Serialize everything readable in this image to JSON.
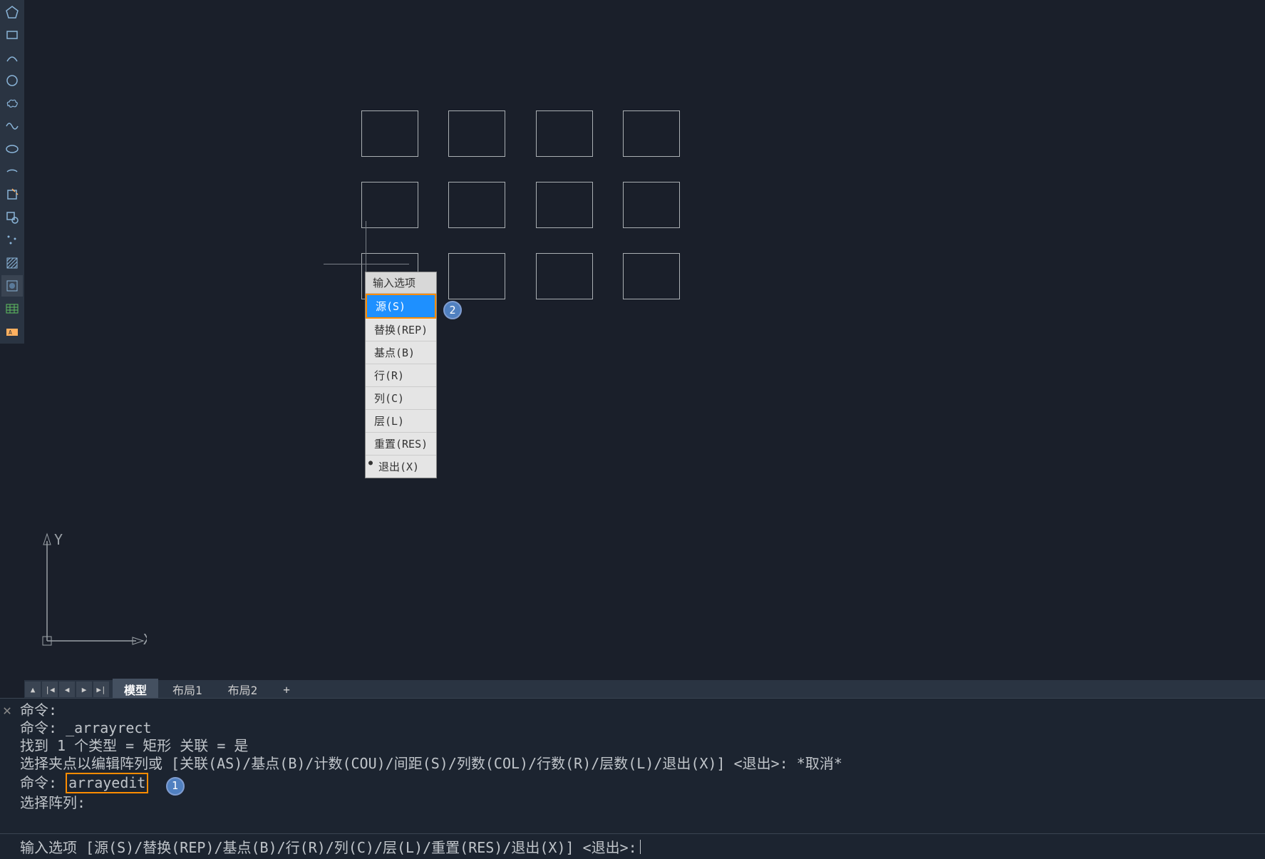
{
  "toolbar": {
    "tools": [
      {
        "name": "polygon",
        "glyph": "⬠"
      },
      {
        "name": "rectangle",
        "glyph": "▭"
      },
      {
        "name": "arc",
        "glyph": "◠"
      },
      {
        "name": "circle",
        "glyph": "◯"
      },
      {
        "name": "revision-cloud",
        "glyph": "☁"
      },
      {
        "name": "spline",
        "glyph": "∿"
      },
      {
        "name": "ellipse",
        "glyph": "⬭"
      },
      {
        "name": "ellipse-arc",
        "glyph": "◖"
      },
      {
        "name": "insert-block",
        "glyph": "⬚"
      },
      {
        "name": "make-block",
        "glyph": "⊡"
      },
      {
        "name": "point",
        "glyph": "∴"
      },
      {
        "name": "hatch",
        "glyph": "▨"
      },
      {
        "name": "gradient",
        "glyph": "◫"
      },
      {
        "name": "table",
        "glyph": "▦"
      },
      {
        "name": "text",
        "glyph": "A"
      }
    ]
  },
  "context_menu": {
    "header": "输入选项",
    "items": [
      {
        "label": "源(S)",
        "selected": true,
        "bullet": false
      },
      {
        "label": "替换(REP)",
        "selected": false,
        "bullet": false
      },
      {
        "label": "基点(B)",
        "selected": false,
        "bullet": false
      },
      {
        "label": "行(R)",
        "selected": false,
        "bullet": false
      },
      {
        "label": "列(C)",
        "selected": false,
        "bullet": false
      },
      {
        "label": "层(L)",
        "selected": false,
        "bullet": false
      },
      {
        "label": "重置(RES)",
        "selected": false,
        "bullet": false
      },
      {
        "label": "退出(X)",
        "selected": false,
        "bullet": true
      }
    ]
  },
  "badges": {
    "b1": "1",
    "b2": "2"
  },
  "axes": {
    "x": "X",
    "y": "Y"
  },
  "tabs": {
    "items": [
      {
        "label": "模型",
        "active": true
      },
      {
        "label": "布局1",
        "active": false
      },
      {
        "label": "布局2",
        "active": false
      },
      {
        "label": "+",
        "active": false
      }
    ]
  },
  "command_history": {
    "l1": "命令:",
    "l2": "命令: _arrayrect",
    "l3": "找到 1 个类型 = 矩形   关联 = 是",
    "l4": "选择夹点以编辑阵列或 [关联(AS)/基点(B)/计数(COU)/间距(S)/列数(COL)/行数(R)/层数(L)/退出(X)] <退出>: *取消*",
    "l5_pre": "命令:",
    "l5_cmd": "arrayedit",
    "l6": "选择阵列:"
  },
  "command_input": {
    "prompt": "输入选项 [源(S)/替换(REP)/基点(B)/行(R)/列(C)/层(L)/重置(RES)/退出(X)] <退出>:"
  }
}
